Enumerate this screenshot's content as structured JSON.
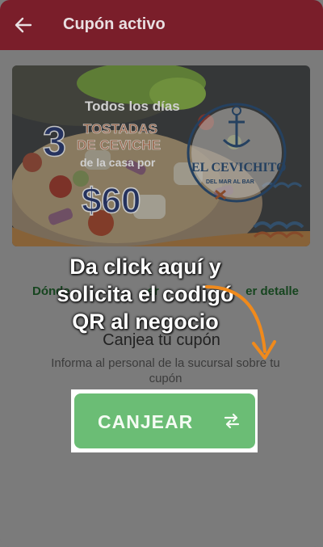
{
  "appbar": {
    "title": "Cupón activo",
    "back_icon": "arrow-left-icon"
  },
  "banner": {
    "line1": "Todos los días",
    "number": "3",
    "line2": "TOSTADAS",
    "line3": "DE CEVICHE",
    "line4": "de la casa por",
    "price": "$60",
    "brand": "EL CEVICHITO",
    "tagline": "DEL MAR AL BAR"
  },
  "links": {
    "left": "Dónde",
    "left_suffix": "er",
    "right": "er detalle"
  },
  "redeem": {
    "title": "Canjea tu cupón",
    "description": "Informa al personal de la sucursal sobre tu cupón",
    "button_label": "CANJEAR",
    "button_icon": "swap-arrows-icon"
  },
  "callout": {
    "line1": "Da click aquí y",
    "line2": "solicita el codigó",
    "line3": "QR al negocio"
  },
  "colors": {
    "appbar": "#7a1e2a",
    "overlay": "#7b7b7b",
    "button": "#6bbd75",
    "arrow": "#f08a1c",
    "link": "#16451f"
  }
}
